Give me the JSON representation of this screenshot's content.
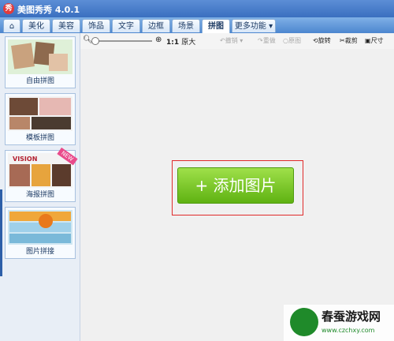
{
  "app": {
    "title": "美图秀秀 4.0.1",
    "logo_glyph": "秀"
  },
  "tabs": [
    {
      "label": "⌂",
      "name": "home"
    },
    {
      "label": "美化"
    },
    {
      "label": "美容"
    },
    {
      "label": "饰品"
    },
    {
      "label": "文字"
    },
    {
      "label": "边框"
    },
    {
      "label": "场景"
    },
    {
      "label": "拼图",
      "active": true
    },
    {
      "label": "更多功能 ▾"
    }
  ],
  "sidebar": {
    "items": [
      {
        "label": "自由拼图"
      },
      {
        "label": "模板拼图"
      },
      {
        "label": "海报拼图",
        "badge": "NEW",
        "thumb_text": "VISION"
      },
      {
        "label": "图片拼接"
      }
    ]
  },
  "toolbar": {
    "ratio_label": "1:1",
    "zoom_label": "原大",
    "undo": "撤销",
    "redo": "重做",
    "reset": "原图",
    "rotate": "旋转",
    "crop": "裁剪",
    "size": "尺寸"
  },
  "canvas": {
    "add_button_label": "+ 添加图片"
  },
  "watermark": {
    "cn": "春蚕游戏网",
    "url": "www.czchxy.com"
  },
  "colors": {
    "accent": "#3a6fc0",
    "button_green": "#6cc41b",
    "highlight_red": "#e02a2a"
  }
}
